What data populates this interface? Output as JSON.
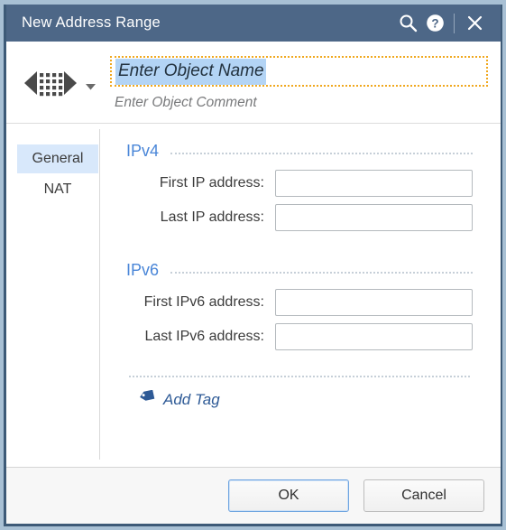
{
  "window": {
    "title": "New Address Range",
    "titlebar_buttons": [
      {
        "name": "search-icon",
        "label": "Search"
      },
      {
        "name": "help-icon",
        "label": "Help"
      },
      {
        "name": "close-icon",
        "label": "Close"
      }
    ],
    "colors": {
      "titlebar_bg": "#4d6787",
      "accent_blue": "#4a86d8",
      "selection_blue": "#b3d4f5",
      "tab_selected_bg": "#d8e8fb",
      "input_focus_border": "#f0a81e",
      "link_blue": "#2e5a96",
      "border": "#3d5a77"
    }
  },
  "object_header": {
    "icon_name": "address-range-icon",
    "dropdown_icon_name": "chevron-down-icon",
    "name_value": "Enter Object Name",
    "name_placeholder": "Enter Object Name",
    "comment_value": "Enter Object Comment",
    "comment_placeholder": "Enter Object Comment"
  },
  "tabs": [
    {
      "label": "General",
      "selected": true
    },
    {
      "label": "NAT",
      "selected": false
    }
  ],
  "sections": [
    {
      "title": "IPv4",
      "fields": [
        {
          "label": "First IP address:",
          "value": "",
          "placeholder": ""
        },
        {
          "label": "Last IP address:",
          "value": "",
          "placeholder": ""
        }
      ]
    },
    {
      "title": "IPv6",
      "fields": [
        {
          "label": "First IPv6 address:",
          "value": "",
          "placeholder": ""
        },
        {
          "label": "Last IPv6 address:",
          "value": "",
          "placeholder": ""
        }
      ]
    }
  ],
  "add_tag": {
    "label": "Add Tag",
    "icon_name": "tag-icon"
  },
  "footer": {
    "ok_label": "OK",
    "cancel_label": "Cancel"
  }
}
